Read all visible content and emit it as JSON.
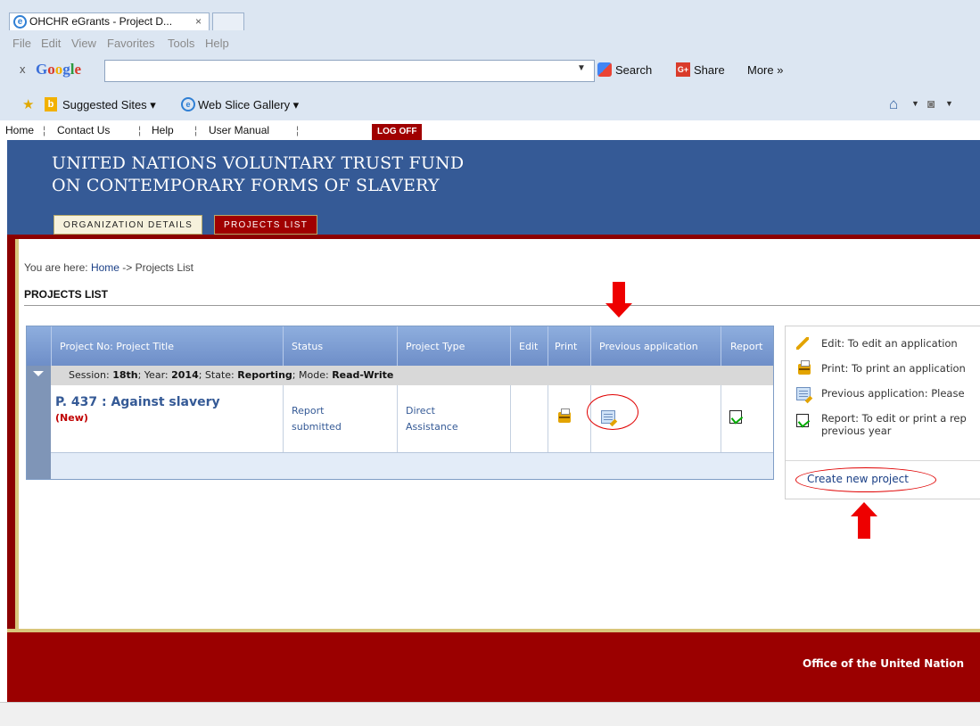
{
  "browser": {
    "tab_title": "OHCHR eGrants - Project D...",
    "tab_close": "×",
    "menu": [
      "File",
      "Edit",
      "View",
      "Favorites",
      "Tools",
      "Help"
    ],
    "google": {
      "close": "x",
      "logo": "Google",
      "search_value": "",
      "search_label": "Search",
      "share_label": "Share",
      "more_label": "More »"
    },
    "favorites": {
      "suggested": "Suggested Sites ▾",
      "webslice": "Web Slice Gallery ▾"
    }
  },
  "site_links": {
    "home": "Home",
    "contact": "Contact Us",
    "help": "Help",
    "manual": "User Manual",
    "logoff": "LOG OFF",
    "separator": "¦"
  },
  "header": {
    "title_line1": "UNITED NATIONS VOLUNTARY TRUST FUND",
    "title_line2": "ON CONTEMPORARY FORMS OF SLAVERY",
    "tabs": [
      {
        "label": "ORGANIZATION DETAILS"
      },
      {
        "label": "PROJECTS LIST"
      }
    ]
  },
  "breadcrumb": {
    "prefix": "You are here: ",
    "home": "Home",
    "rest": " -> Projects List"
  },
  "page_title": "PROJECTS LIST",
  "table": {
    "headers": [
      "Project No: Project Title",
      "Status",
      "Project Type",
      "Edit",
      "Print",
      "Previous application",
      "Report"
    ],
    "session": {
      "l1": "Session: ",
      "v1": "18th",
      "l2": "; Year: ",
      "v2": "2014",
      "l3": "; State: ",
      "v3": "Reporting",
      "l4": "; Mode: ",
      "v4": "Read-Write"
    },
    "rows": [
      {
        "title": "P. 437 : Against slavery",
        "badge": "(New)",
        "status_line1": "Report",
        "status_line2": "submitted",
        "type_line1": "Direct",
        "type_line2": "Assistance"
      }
    ]
  },
  "legend": {
    "edit": "Edit: To edit an application",
    "print": "Print: To print an application",
    "previous": "Previous application: Please",
    "report_line1": "Report: To edit or print a rep",
    "report_line2": "previous year",
    "create": "Create new project"
  },
  "footer": {
    "text": "Office of the United Nation"
  },
  "colors": {
    "header_blue": "#355a96",
    "brand_red": "#9b0000",
    "annotation_red": "#ee0000"
  }
}
